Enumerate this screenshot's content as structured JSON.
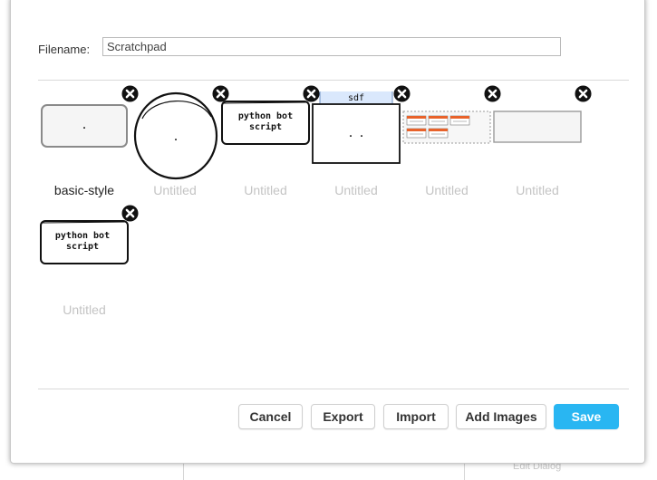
{
  "background": {
    "bottom_right_text": "Edit Dialog"
  },
  "dialog": {
    "filename_label": "Filename:",
    "filename_value": "Scratchpad"
  },
  "library_items": [
    {
      "caption": "basic-style",
      "thumb_text": "."
    },
    {
      "caption": "Untitled",
      "thumb_text": "."
    },
    {
      "caption": "Untitled",
      "thumb_text_1": "python bot",
      "thumb_text_2": "script"
    },
    {
      "caption": "Untitled",
      "thumb_header": "sdf",
      "thumb_text": ". ."
    },
    {
      "caption": "Untitled"
    },
    {
      "caption": "Untitled"
    },
    {
      "caption": "Untitled",
      "thumb_text_1": "python bot",
      "thumb_text_2": "script"
    }
  ],
  "buttons": {
    "cancel": "Cancel",
    "export": "Export",
    "import": "Import",
    "add_images": "Add Images",
    "save": "Save"
  },
  "colors": {
    "accent": "#29b6f2",
    "close_icon": "#111111",
    "thumb_header": "#dae8fc",
    "widget_orange": "#e8622a"
  }
}
